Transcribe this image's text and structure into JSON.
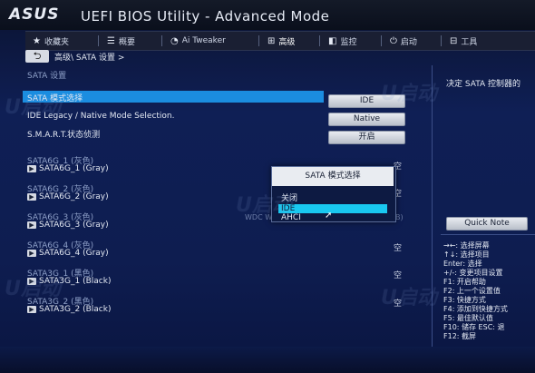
{
  "header": {
    "logo": "ASUS",
    "title": "UEFI BIOS Utility - Advanced Mode"
  },
  "menu": [
    {
      "icon": "★",
      "label": "收藏夹"
    },
    {
      "icon": "☰",
      "label": "概要"
    },
    {
      "icon": "◔",
      "label": "Ai Tweaker"
    },
    {
      "icon": "⊞",
      "label": "高级"
    },
    {
      "icon": "◧",
      "label": "监控"
    },
    {
      "icon": "⏻",
      "label": "启动"
    },
    {
      "icon": "⊟",
      "label": "工具"
    }
  ],
  "breadcrumb": {
    "back": "⮌",
    "path": "高级\\ SATA 设置 >"
  },
  "section_title": "SATA 设置",
  "settings": [
    {
      "label": "SATA 模式选择",
      "value": "IDE"
    },
    {
      "label": "IDE Legacy / Native Mode Selection.",
      "value": "Native"
    },
    {
      "label": "S.M.A.R.T.状态侦测",
      "value": "开启"
    }
  ],
  "ports": [
    {
      "port": "SATA6G_1 (灰色)",
      "device": "SATA6G_1 (Gray)",
      "status": "空"
    },
    {
      "port": "SATA6G_2 (灰色)",
      "device": "SATA6G_2 (Gray)",
      "status": "空"
    },
    {
      "port": "SATA6G_3 (灰色)",
      "device": "SATA6G_3 (Gray)",
      "status": ""
    },
    {
      "port": "SATA6G_4 (灰色)",
      "device": "SATA6G_4 (Gray)",
      "status": "空"
    },
    {
      "port": "SATA3G_1 (黑色)",
      "device": "SATA3G_1 (Black)",
      "status": "空"
    },
    {
      "port": "SATA3G_2 (黑色)",
      "device": "SATA3G_2 (Black)",
      "status": "空"
    }
  ],
  "hidden_fragments": {
    "wdc": "WDC W",
    "b_paren": "B)"
  },
  "popup": {
    "title": "SATA 模式选择",
    "options": [
      "关闭",
      "IDE",
      "AHCI"
    ],
    "selected": "IDE"
  },
  "help": {
    "description": "决定 SATA 控制器的",
    "quick_note": "Quick Note",
    "keys": [
      "→←: 选择屏幕",
      "↑↓: 选择项目",
      "Enter: 选择",
      "+/-: 变更项目设置",
      "F1: 开启帮助",
      "F2: 上一个设置值",
      "F3: 快捷方式",
      "F4: 添加到快捷方式",
      "F5: 最佳默认值",
      "F10: 储存  ESC: 退",
      "F12: 截屏"
    ]
  },
  "watermark": "U启动"
}
